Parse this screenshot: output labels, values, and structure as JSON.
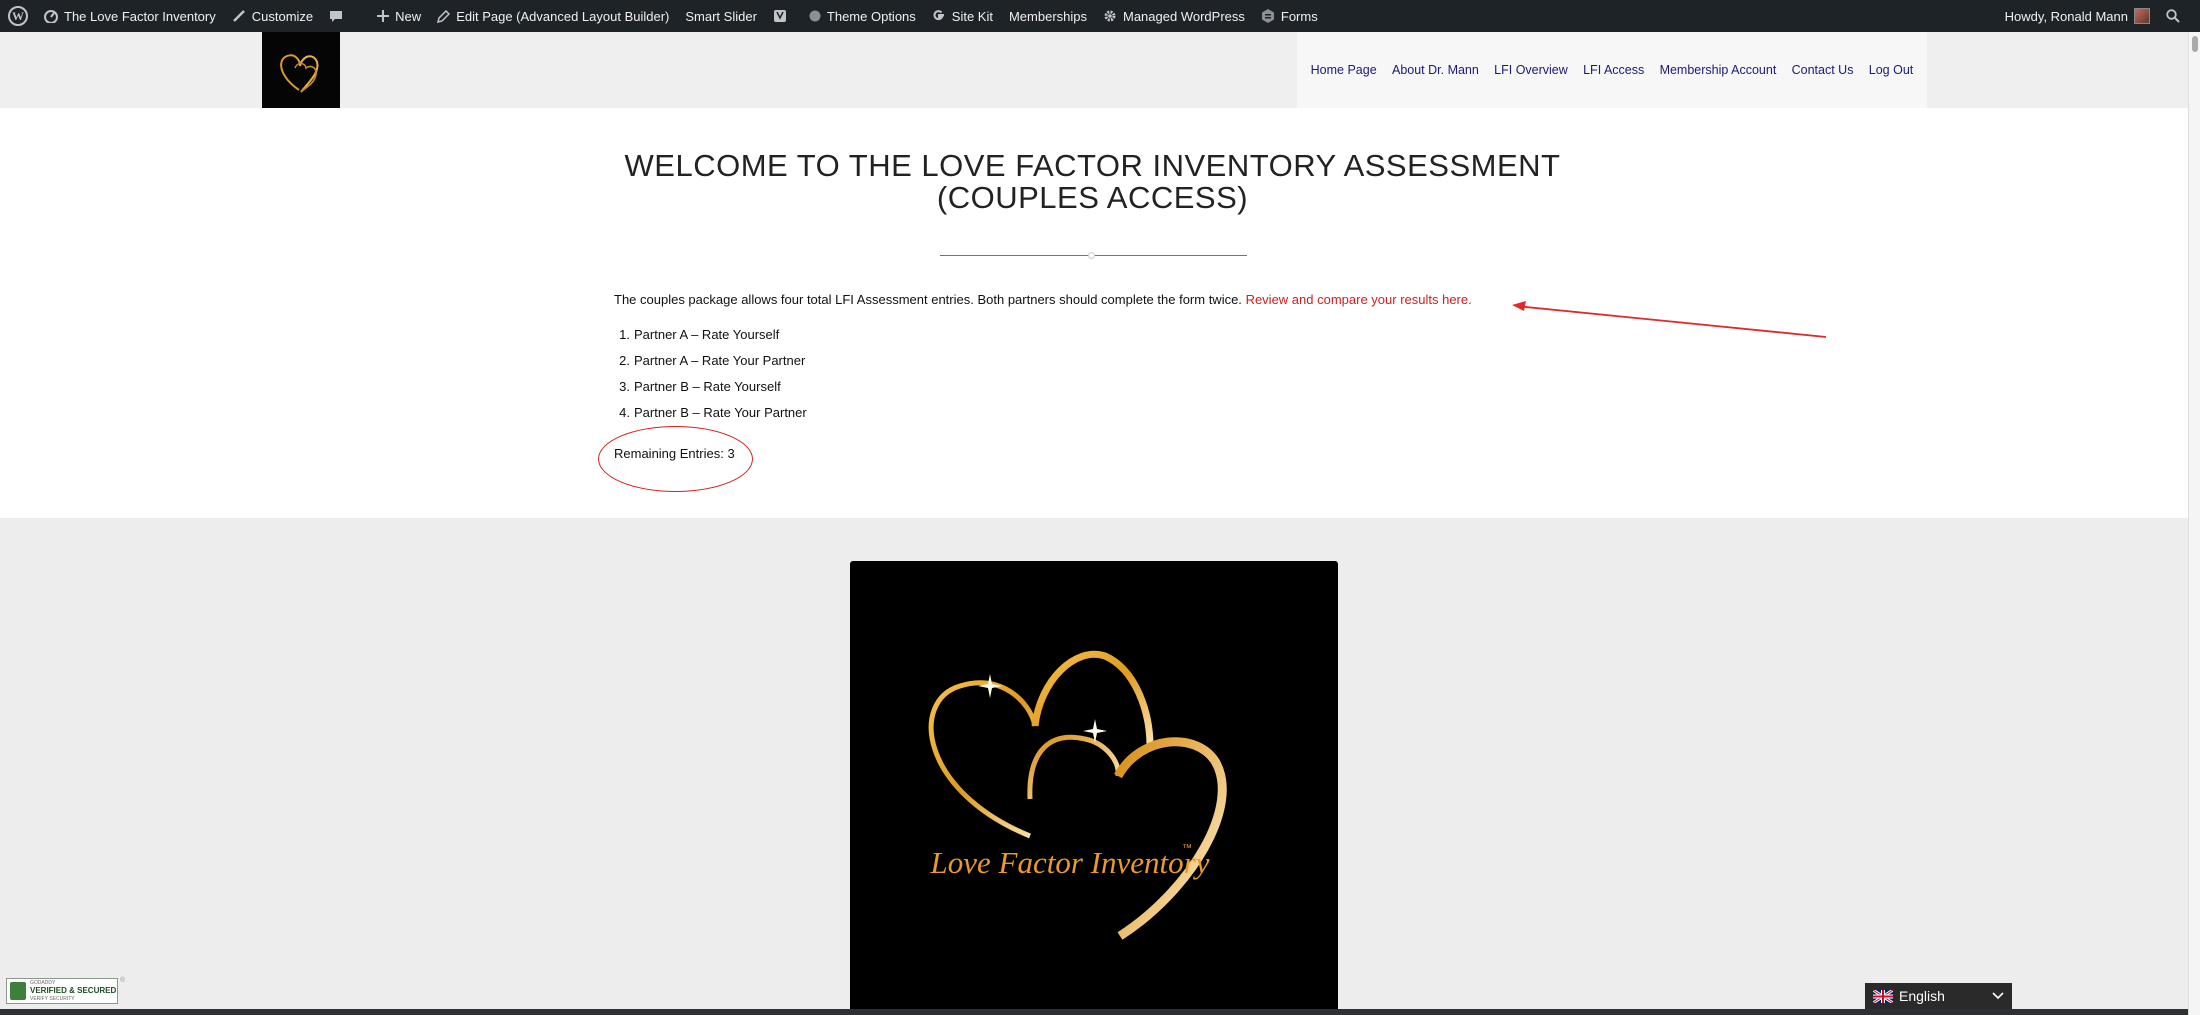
{
  "admin_bar": {
    "items": [
      {
        "label": "The Love Factor Inventory",
        "icon": "home-dashboard-icon"
      },
      {
        "label": "Customize",
        "icon": "brush-icon"
      },
      {
        "label": "",
        "icon": "comment-icon"
      },
      {
        "label": "New",
        "icon": "plus-icon"
      },
      {
        "label": "Edit Page (Advanced Layout Builder)",
        "icon": "pencil-icon"
      },
      {
        "label": "Smart Slider",
        "icon": ""
      },
      {
        "label": "",
        "icon": "yoast-icon"
      },
      {
        "label": "Theme Options",
        "icon": "circle-icon"
      },
      {
        "label": "Site Kit",
        "icon": "google-icon"
      },
      {
        "label": "Memberships",
        "icon": ""
      },
      {
        "label": "Managed WordPress",
        "icon": "gear-icon"
      },
      {
        "label": "Forms",
        "icon": "forms-icon"
      }
    ],
    "howdy": "Howdy, Ronald Mann"
  },
  "nav": {
    "items": [
      "Home Page",
      "About Dr. Mann",
      "LFI Overview",
      "LFI Access",
      "Membership Account",
      "Contact Us",
      "Log Out"
    ]
  },
  "main": {
    "title_line1": "WELCOME TO THE LOVE FACTOR INVENTORY ASSESSMENT",
    "title_line2": "(COUPLES ACCESS)",
    "intro_text": "The couples package allows four total LFI Assessment entries. Both partners should complete the form twice.",
    "intro_link": "Review and compare your results here.",
    "steps": [
      {
        "num": "1.",
        "text": "Partner A – Rate Yourself"
      },
      {
        "num": "2.",
        "text": "Partner A – Rate Your Partner"
      },
      {
        "num": "3.",
        "text": "Partner B – Rate Yourself"
      },
      {
        "num": "4.",
        "text": "Partner B – Rate Your Partner"
      }
    ],
    "remaining": "Remaining Entries: 3"
  },
  "hero": {
    "brand": "Love Factor Inventory",
    "tm": "™"
  },
  "badge": {
    "line1": "GODADDY",
    "line2": "VERIFIED & SECURED",
    "line3": "VERIFY SECURITY",
    "reg": "®"
  },
  "language": {
    "selected": "English"
  },
  "colors": {
    "admin_bar": "#1d2327",
    "nav_link": "#1a1a7a",
    "accent_red": "#cc1f1f",
    "gold": "#e8a93a"
  }
}
